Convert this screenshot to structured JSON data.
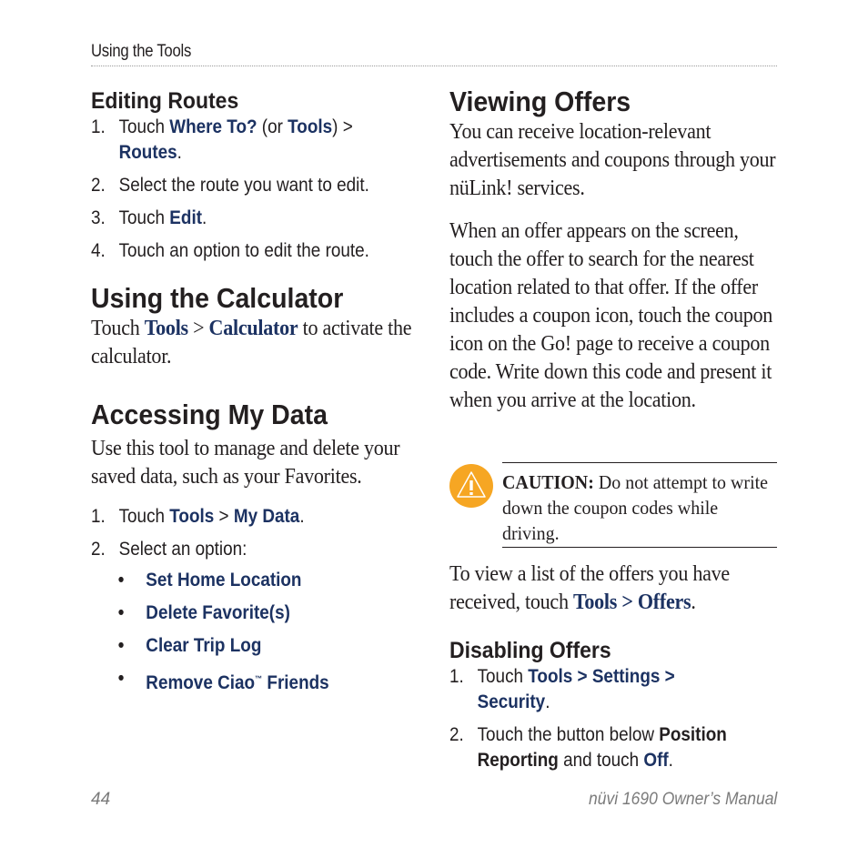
{
  "running_head": "Using the Tools",
  "footer": {
    "page_number": "44",
    "manual_title": "nüvi 1690 Owner’s Manual"
  },
  "editing_routes": {
    "heading": "Editing Routes",
    "steps": [
      {
        "num": "1.",
        "t1": "Touch ",
        "b1": "Where To?",
        "t2": " (or ",
        "b2": "Tools",
        "t3": ") >",
        "b3": "Routes",
        "t4": "."
      },
      {
        "num": "2.",
        "text": "Select the route you want to edit."
      },
      {
        "num": "3.",
        "t1": "Touch ",
        "b1": "Edit",
        "t2": "."
      },
      {
        "num": "4.",
        "text": "Touch an option to edit the route."
      }
    ]
  },
  "calculator": {
    "heading": "Using the Calculator",
    "t1": "Touch ",
    "b1": "Tools",
    "t2": " > ",
    "b2": "Calculator",
    "t3": " to activate the calculator."
  },
  "my_data": {
    "heading": "Accessing My Data",
    "intro": "Use this tool to manage and delete your saved data, such as your Favorites.",
    "steps": [
      {
        "num": "1.",
        "t1": "Touch ",
        "b1": "Tools",
        "t2": " > ",
        "b2": "My Data",
        "t3": "."
      },
      {
        "num": "2.",
        "text": "Select an option:"
      }
    ],
    "options": [
      "Set Home Location",
      "Delete Favorite(s)",
      "Clear Trip Log",
      "Remove Ciao",
      "Friends"
    ],
    "trademark": "™",
    "bullet": "•"
  },
  "viewing_offers": {
    "heading": "Viewing Offers",
    "para1": "You can receive location-relevant advertisements and coupons through your nüLink! services.",
    "para2": "When an offer appears on the screen, touch the offer to search for the nearest location related to that offer. If the offer includes a coupon icon, touch the coupon icon on the Go! page to receive a coupon code. Write down this code and present it when you arrive at the location.",
    "caution_label": "CAUTION:",
    "caution_text": " Do not attempt to write down the coupon codes while driving.",
    "para3_t1": "To view a list of the offers you have received, touch ",
    "para3_b1": "Tools > Offers",
    "para3_t2": "."
  },
  "disabling_offers": {
    "heading": "Disabling Offers",
    "steps": [
      {
        "num": "1.",
        "t1": "Touch ",
        "b1": "Tools > Settings >",
        "b2": "Security",
        "t2": "."
      },
      {
        "num": "2.",
        "t1": "Touch the button below ",
        "k1": "Position Reporting",
        "t2": " and touch ",
        "b1": "Off",
        "t3": "."
      }
    ]
  },
  "colors": {
    "link_blue": "#1c3262",
    "caution_orange": "#f6a623",
    "text": "#231f20",
    "footer_gray": "#7b7b7b"
  }
}
